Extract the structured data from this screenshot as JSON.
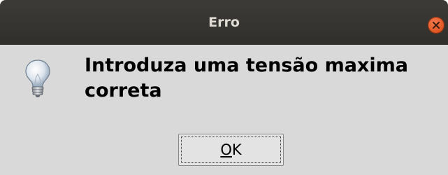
{
  "window": {
    "title": "Erro"
  },
  "titlebar": {
    "close_icon": "close-icon",
    "close_color": "#e95420"
  },
  "dialog": {
    "icon": "lightbulb-icon",
    "message": "Introduza uma tensão maxima\ncorreta",
    "button": {
      "mnemonic": "O",
      "rest": "K"
    }
  },
  "colors": {
    "titlebar_bg": "#3c3b37",
    "title_text": "#dfdbd2",
    "dialog_bg": "#d9d9d9",
    "button_bg": "#e3e3e3"
  }
}
